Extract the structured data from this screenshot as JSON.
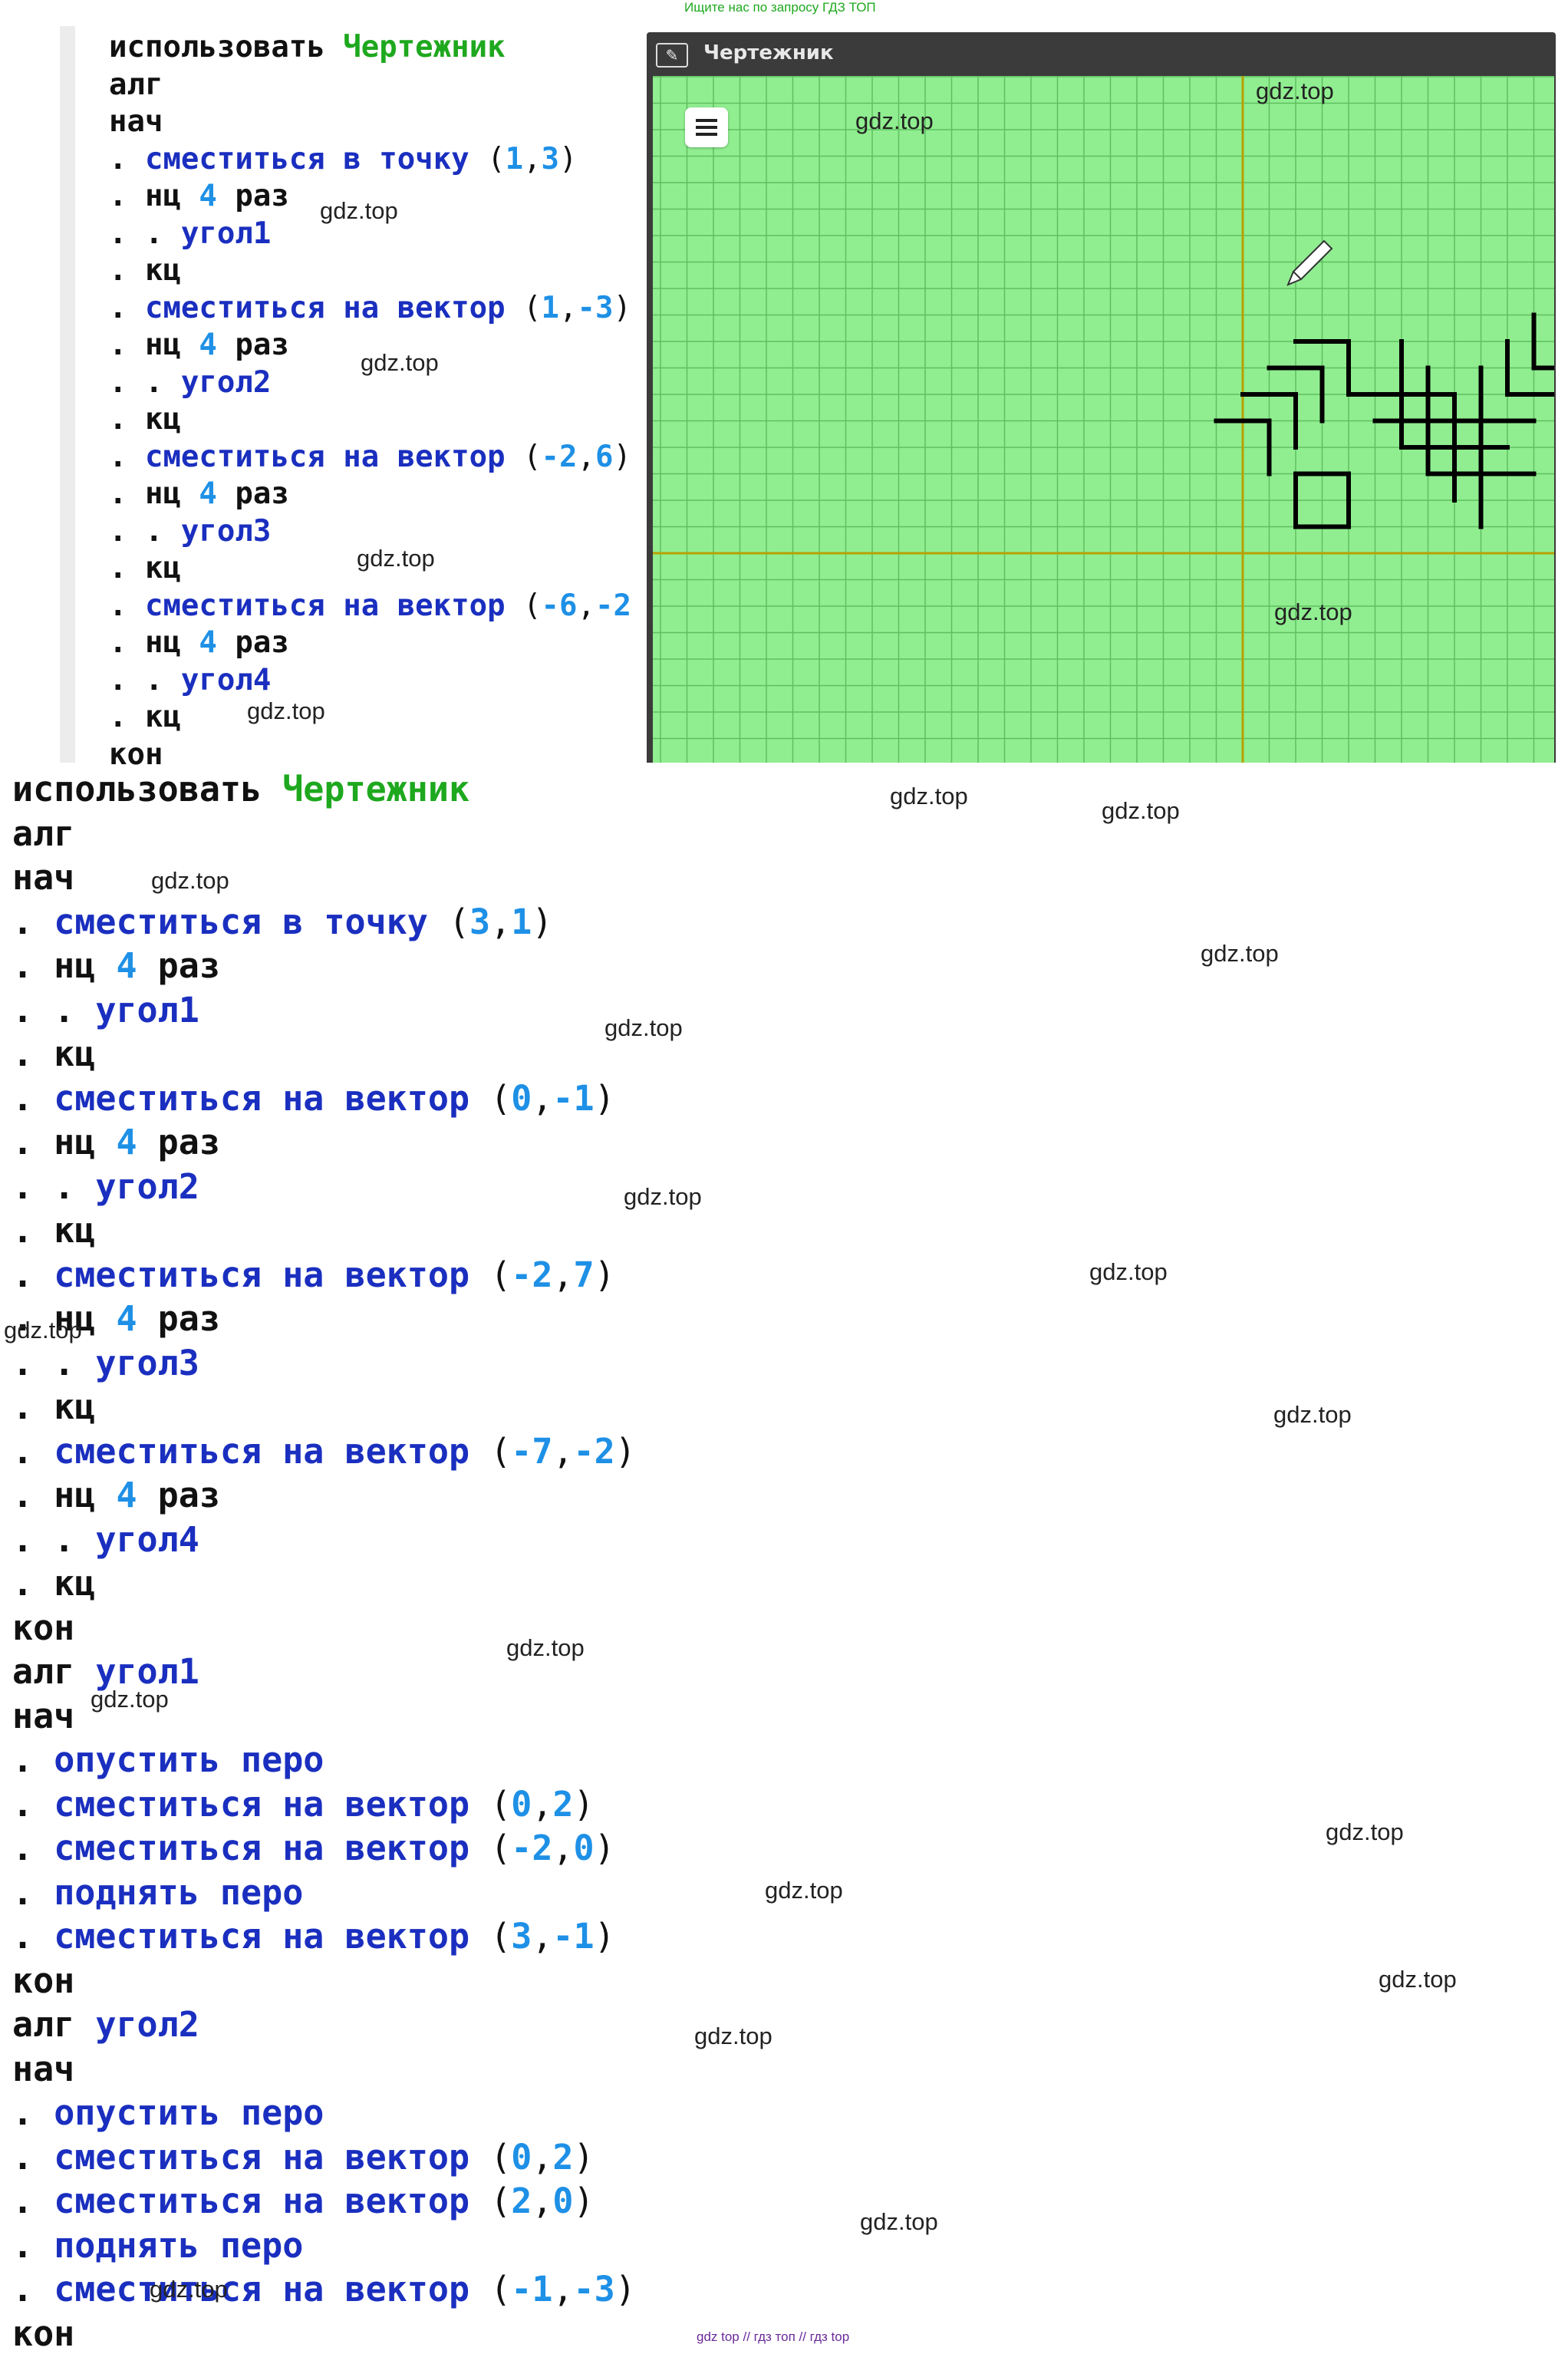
{
  "top_note": "Ищите нас по запросу ГДЗ ТОП",
  "footer_note": "gdz top  //  гдз топ  //  гдз top",
  "watermark": "gdz.top",
  "drawer": {
    "title": "Чертежник",
    "colors": {
      "grid_bg": "#90ee90",
      "grid_line": "#5fbf5f",
      "axis": "#b8a000",
      "stroke": "#000000"
    }
  },
  "code_top": [
    {
      "n": "l0",
      "parts": [
        [
          "kw",
          "использовать "
        ],
        [
          "grn",
          "Чертежник"
        ]
      ]
    },
    {
      "n": "l1",
      "parts": [
        [
          "kw",
          "алг"
        ]
      ]
    },
    {
      "n": "l2",
      "parts": [
        [
          "kw",
          "нач"
        ]
      ]
    },
    {
      "n": "l3",
      "parts": [
        [
          "kw",
          ". "
        ],
        [
          "cmd",
          "сместиться в точку "
        ],
        [
          "punct",
          "("
        ],
        [
          "num",
          "1"
        ],
        [
          "punct",
          ","
        ],
        [
          "num",
          "3"
        ],
        [
          "punct",
          ")"
        ]
      ]
    },
    {
      "n": "l4",
      "parts": [
        [
          "kw",
          ". нц "
        ],
        [
          "num",
          "4"
        ],
        [
          "kw",
          " раз"
        ]
      ]
    },
    {
      "n": "l5",
      "parts": [
        [
          "kw",
          ". . "
        ],
        [
          "cmd",
          "угол1"
        ]
      ]
    },
    {
      "n": "l6",
      "parts": [
        [
          "kw",
          ". кц"
        ]
      ]
    },
    {
      "n": "l7",
      "parts": [
        [
          "kw",
          ". "
        ],
        [
          "cmd",
          "сместиться на вектор "
        ],
        [
          "punct",
          "("
        ],
        [
          "num",
          "1"
        ],
        [
          "punct",
          ","
        ],
        [
          "num",
          "-3"
        ],
        [
          "punct",
          ")"
        ]
      ]
    },
    {
      "n": "l8",
      "parts": [
        [
          "kw",
          ". нц "
        ],
        [
          "num",
          "4"
        ],
        [
          "kw",
          " раз"
        ]
      ]
    },
    {
      "n": "l9",
      "parts": [
        [
          "kw",
          ". . "
        ],
        [
          "cmd",
          "угол2"
        ]
      ]
    },
    {
      "n": "l10",
      "parts": [
        [
          "kw",
          ". кц"
        ]
      ]
    },
    {
      "n": "l11",
      "parts": [
        [
          "kw",
          ". "
        ],
        [
          "cmd",
          "сместиться на вектор "
        ],
        [
          "punct",
          "("
        ],
        [
          "num",
          "-2"
        ],
        [
          "punct",
          ","
        ],
        [
          "num",
          "6"
        ],
        [
          "punct",
          ")"
        ]
      ]
    },
    {
      "n": "l12",
      "parts": [
        [
          "kw",
          ". нц "
        ],
        [
          "num",
          "4"
        ],
        [
          "kw",
          " раз"
        ]
      ]
    },
    {
      "n": "l13",
      "parts": [
        [
          "kw",
          ". . "
        ],
        [
          "cmd",
          "угол3"
        ]
      ]
    },
    {
      "n": "l14",
      "parts": [
        [
          "kw",
          ". кц"
        ]
      ]
    },
    {
      "n": "l15",
      "parts": [
        [
          "kw",
          ". "
        ],
        [
          "cmd",
          "сместиться на вектор "
        ],
        [
          "punct",
          "("
        ],
        [
          "num",
          "-6"
        ],
        [
          "punct",
          ","
        ],
        [
          "num",
          "-2"
        ]
      ]
    },
    {
      "n": "l16",
      "parts": [
        [
          "kw",
          ". нц "
        ],
        [
          "num",
          "4"
        ],
        [
          "kw",
          " раз"
        ]
      ]
    },
    {
      "n": "l17",
      "parts": [
        [
          "kw",
          ". . "
        ],
        [
          "cmd",
          "угол4"
        ]
      ]
    },
    {
      "n": "l18",
      "parts": [
        [
          "kw",
          ". кц"
        ]
      ]
    },
    {
      "n": "l19",
      "parts": [
        [
          "kw",
          "кон"
        ]
      ]
    }
  ],
  "code_bottom": [
    {
      "n": "b0",
      "parts": [
        [
          "kw",
          "использовать "
        ],
        [
          "grn",
          "Чертежник"
        ]
      ]
    },
    {
      "n": "b1",
      "parts": [
        [
          "kw",
          "алг"
        ]
      ]
    },
    {
      "n": "b2",
      "parts": [
        [
          "kw",
          "нач"
        ]
      ]
    },
    {
      "n": "b3",
      "parts": [
        [
          "kw",
          ". "
        ],
        [
          "cmd",
          "сместиться в точку "
        ],
        [
          "punct",
          "("
        ],
        [
          "num",
          "3"
        ],
        [
          "punct",
          ","
        ],
        [
          "num",
          "1"
        ],
        [
          "punct",
          ")"
        ]
      ]
    },
    {
      "n": "b4",
      "parts": [
        [
          "kw",
          ". нц "
        ],
        [
          "num",
          "4"
        ],
        [
          "kw",
          " раз"
        ]
      ]
    },
    {
      "n": "b5",
      "parts": [
        [
          "kw",
          ". . "
        ],
        [
          "cmd",
          "угол1"
        ]
      ]
    },
    {
      "n": "b6",
      "parts": [
        [
          "kw",
          ". кц"
        ]
      ]
    },
    {
      "n": "b7",
      "parts": [
        [
          "kw",
          ". "
        ],
        [
          "cmd",
          "сместиться на вектор "
        ],
        [
          "punct",
          "("
        ],
        [
          "num",
          "0"
        ],
        [
          "punct",
          ","
        ],
        [
          "num",
          "-1"
        ],
        [
          "punct",
          ")"
        ]
      ]
    },
    {
      "n": "b8",
      "parts": [
        [
          "kw",
          ". нц "
        ],
        [
          "num",
          "4"
        ],
        [
          "kw",
          " раз"
        ]
      ]
    },
    {
      "n": "b9",
      "parts": [
        [
          "kw",
          ". . "
        ],
        [
          "cmd",
          "угол2"
        ]
      ]
    },
    {
      "n": "b10",
      "parts": [
        [
          "kw",
          ". кц"
        ]
      ]
    },
    {
      "n": "b11",
      "parts": [
        [
          "kw",
          ". "
        ],
        [
          "cmd",
          "сместиться на вектор "
        ],
        [
          "punct",
          "("
        ],
        [
          "num",
          "-2"
        ],
        [
          "punct",
          ","
        ],
        [
          "num",
          "7"
        ],
        [
          "punct",
          ")"
        ]
      ]
    },
    {
      "n": "b12",
      "parts": [
        [
          "kw",
          ". нц "
        ],
        [
          "num",
          "4"
        ],
        [
          "kw",
          " раз"
        ]
      ]
    },
    {
      "n": "b13",
      "parts": [
        [
          "kw",
          ". . "
        ],
        [
          "cmd",
          "угол3"
        ]
      ]
    },
    {
      "n": "b14",
      "parts": [
        [
          "kw",
          ". кц"
        ]
      ]
    },
    {
      "n": "b15",
      "parts": [
        [
          "kw",
          ". "
        ],
        [
          "cmd",
          "сместиться на вектор "
        ],
        [
          "punct",
          "("
        ],
        [
          "num",
          "-7"
        ],
        [
          "punct",
          ","
        ],
        [
          "num",
          "-2"
        ],
        [
          "punct",
          ")"
        ]
      ]
    },
    {
      "n": "b16",
      "parts": [
        [
          "kw",
          ". нц "
        ],
        [
          "num",
          "4"
        ],
        [
          "kw",
          " раз"
        ]
      ]
    },
    {
      "n": "b17",
      "parts": [
        [
          "kw",
          ". . "
        ],
        [
          "cmd",
          "угол4"
        ]
      ]
    },
    {
      "n": "b18",
      "parts": [
        [
          "kw",
          ". кц"
        ]
      ]
    },
    {
      "n": "b19",
      "parts": [
        [
          "kw",
          "кон"
        ]
      ]
    },
    {
      "n": "b20",
      "parts": [
        [
          "kw",
          "алг "
        ],
        [
          "cmd",
          "угол1"
        ]
      ]
    },
    {
      "n": "b21",
      "parts": [
        [
          "kw",
          "нач"
        ]
      ]
    },
    {
      "n": "b22",
      "parts": [
        [
          "kw",
          ". "
        ],
        [
          "cmd",
          "опустить перо"
        ]
      ]
    },
    {
      "n": "b23",
      "parts": [
        [
          "kw",
          ". "
        ],
        [
          "cmd",
          "сместиться на вектор "
        ],
        [
          "punct",
          "("
        ],
        [
          "num",
          "0"
        ],
        [
          "punct",
          ","
        ],
        [
          "num",
          "2"
        ],
        [
          "punct",
          ")"
        ]
      ]
    },
    {
      "n": "b24",
      "parts": [
        [
          "kw",
          ". "
        ],
        [
          "cmd",
          "сместиться на вектор "
        ],
        [
          "punct",
          "("
        ],
        [
          "num",
          "-2"
        ],
        [
          "punct",
          ","
        ],
        [
          "num",
          "0"
        ],
        [
          "punct",
          ")"
        ]
      ]
    },
    {
      "n": "b25",
      "parts": [
        [
          "kw",
          ". "
        ],
        [
          "cmd",
          "поднять перо"
        ]
      ]
    },
    {
      "n": "b26",
      "parts": [
        [
          "kw",
          ". "
        ],
        [
          "cmd",
          "сместиться на вектор "
        ],
        [
          "punct",
          "("
        ],
        [
          "num",
          "3"
        ],
        [
          "punct",
          ","
        ],
        [
          "num",
          "-1"
        ],
        [
          "punct",
          ")"
        ]
      ]
    },
    {
      "n": "b27",
      "parts": [
        [
          "kw",
          "кон"
        ]
      ]
    },
    {
      "n": "b28",
      "parts": [
        [
          "kw",
          "алг "
        ],
        [
          "cmd",
          "угол2"
        ]
      ]
    },
    {
      "n": "b29",
      "parts": [
        [
          "kw",
          "нач"
        ]
      ]
    },
    {
      "n": "b30",
      "parts": [
        [
          "kw",
          ". "
        ],
        [
          "cmd",
          "опустить перо"
        ]
      ]
    },
    {
      "n": "b31",
      "parts": [
        [
          "kw",
          ". "
        ],
        [
          "cmd",
          "сместиться на вектор "
        ],
        [
          "punct",
          "("
        ],
        [
          "num",
          "0"
        ],
        [
          "punct",
          ","
        ],
        [
          "num",
          "2"
        ],
        [
          "punct",
          ")"
        ]
      ]
    },
    {
      "n": "b32",
      "parts": [
        [
          "kw",
          ". "
        ],
        [
          "cmd",
          "сместиться на вектор "
        ],
        [
          "punct",
          "("
        ],
        [
          "num",
          "2"
        ],
        [
          "punct",
          ","
        ],
        [
          "num",
          "0"
        ],
        [
          "punct",
          ")"
        ]
      ]
    },
    {
      "n": "b33",
      "parts": [
        [
          "kw",
          ". "
        ],
        [
          "cmd",
          "поднять перо"
        ]
      ]
    },
    {
      "n": "b34",
      "parts": [
        [
          "kw",
          ". "
        ],
        [
          "cmd",
          "сместиться на вектор "
        ],
        [
          "punct",
          "("
        ],
        [
          "num",
          "-1"
        ],
        [
          "punct",
          ","
        ],
        [
          "num",
          "-3"
        ],
        [
          "punct",
          ")"
        ]
      ]
    },
    {
      "n": "b35",
      "parts": [
        [
          "kw",
          "кон"
        ]
      ]
    }
  ]
}
